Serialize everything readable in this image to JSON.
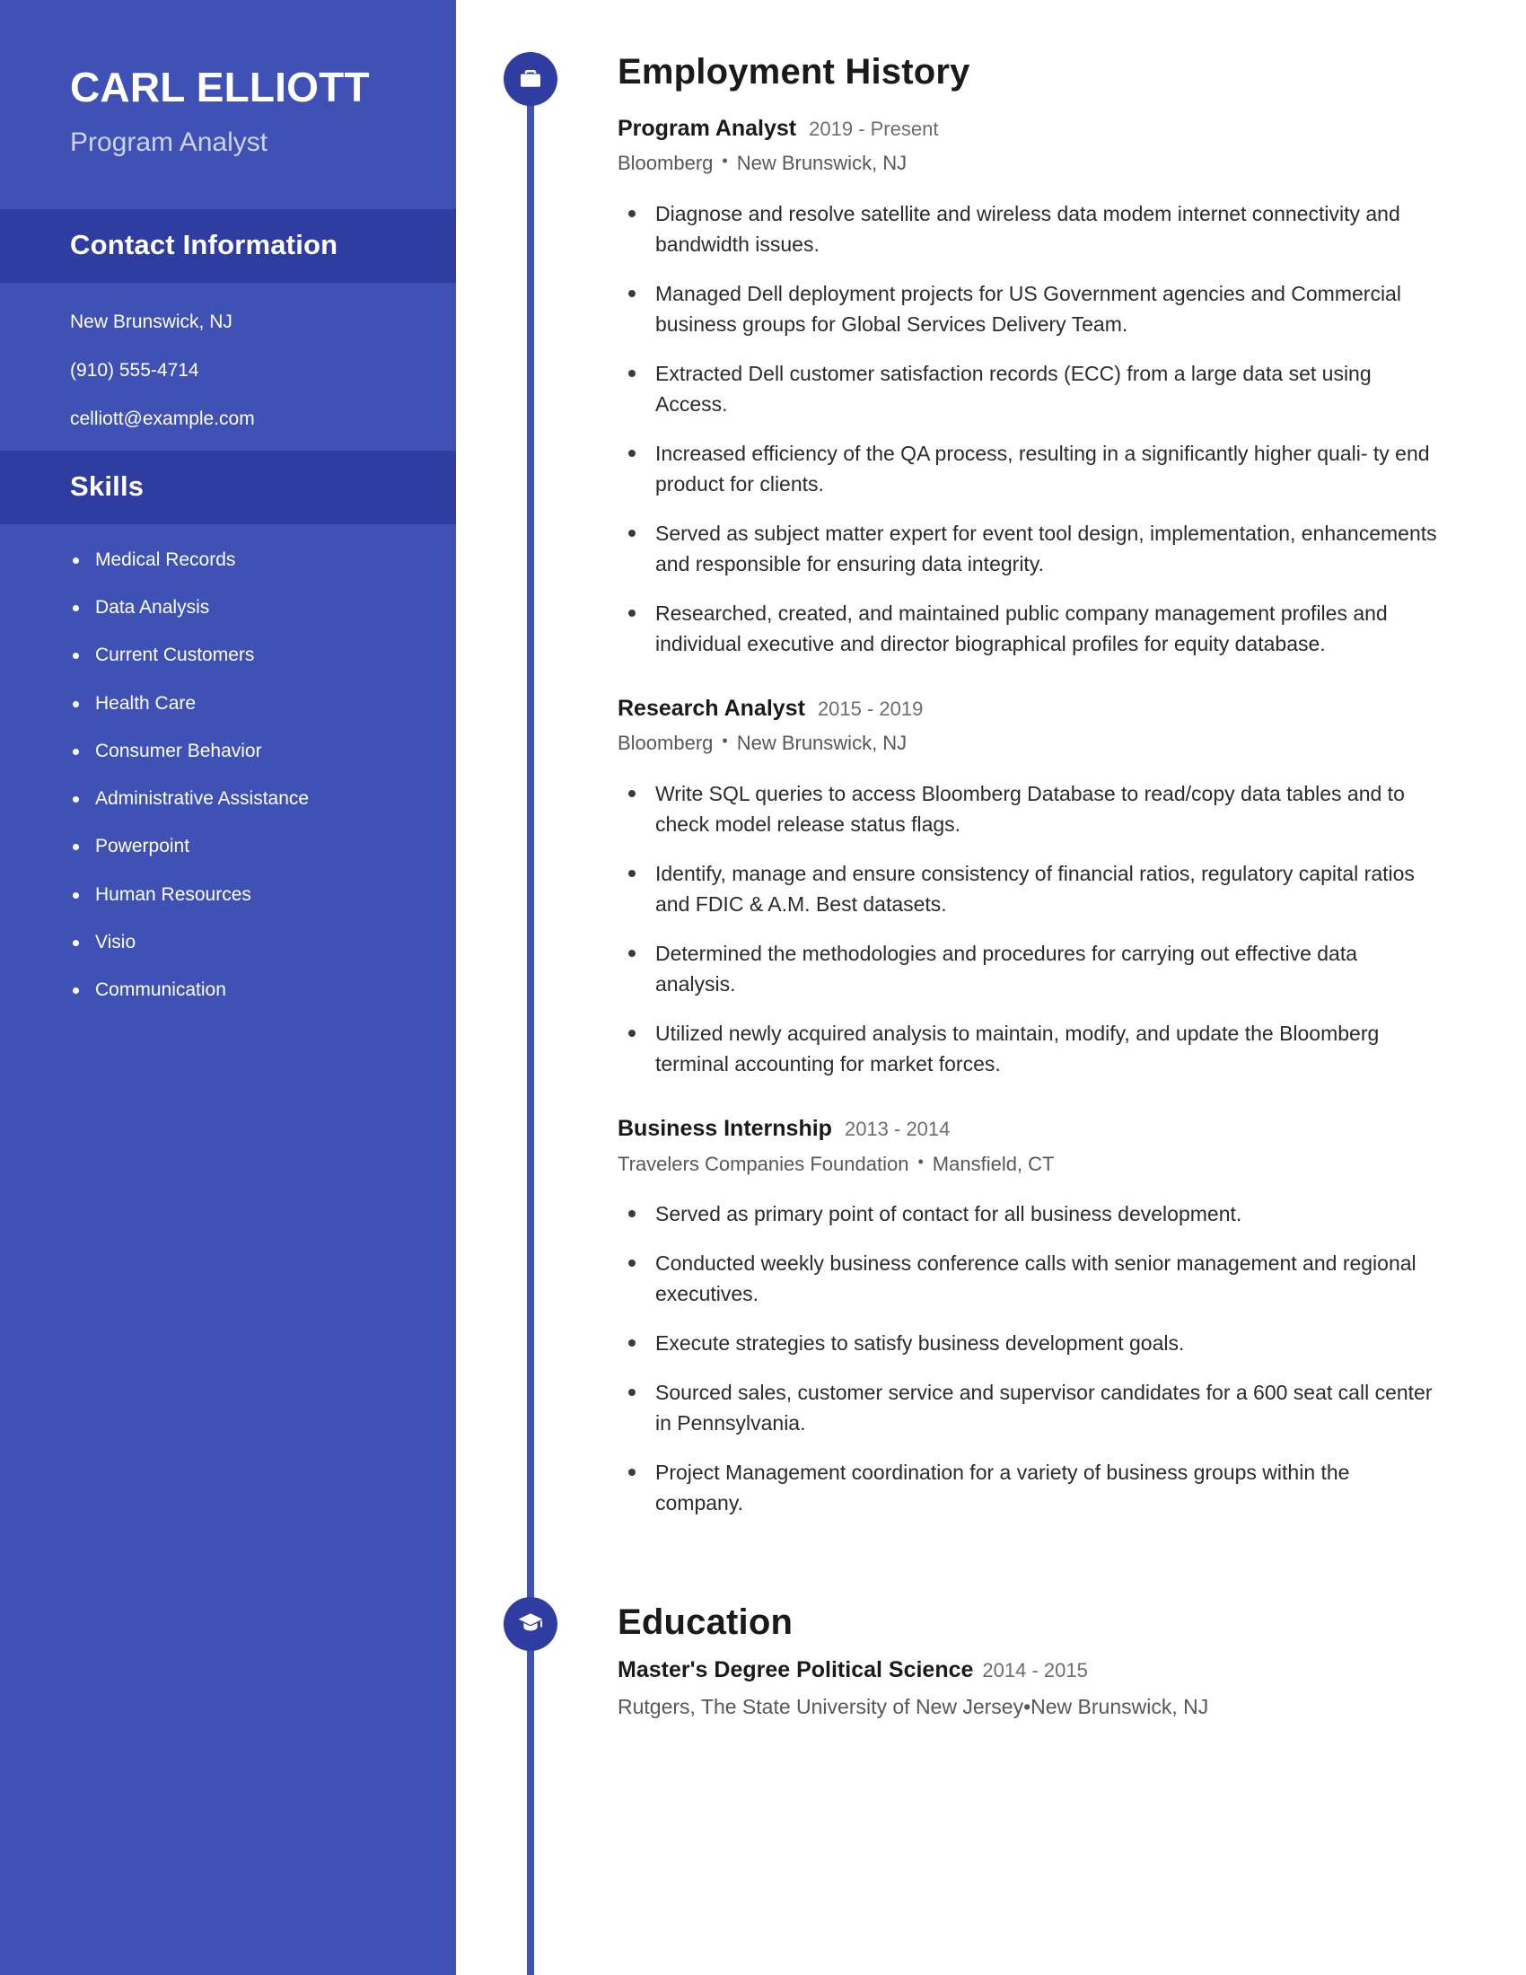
{
  "theme": {
    "sidebar_bg": "#3f51b5",
    "sidebar_band_bg": "#2f3da0",
    "accent": "#3f51b5",
    "icon_bg": "#2f3da0",
    "text_dark": "#1a1a1a",
    "text_muted": "#6d6d6d"
  },
  "sidebar": {
    "name": "CARL ELLIOTT",
    "title": "Program Analyst",
    "contact_heading": "Contact Information",
    "contact": [
      "New Brunswick, NJ",
      "(910) 555-4714",
      "celliott@example.com"
    ],
    "skills_heading": "Skills",
    "skills": [
      "Medical Records",
      "Data Analysis",
      "Current Customers",
      "Health Care",
      "Consumer Behavior",
      "Administrative Assistance",
      "Powerpoint",
      "Human Resources",
      "Visio",
      "Communication"
    ]
  },
  "employment": {
    "heading": "Employment History",
    "icon": "briefcase-icon",
    "entries": [
      {
        "role": "Program Analyst",
        "dates": "2019 - Present",
        "company": "Bloomberg",
        "location": "New Brunswick, NJ",
        "bullets": [
          "Diagnose and resolve satellite and wireless data modem internet connectivity and bandwidth issues.",
          "Managed Dell deployment projects for US Government agencies and Commercial business groups for Global Services Delivery Team.",
          "Extracted Dell customer satisfaction records (ECC) from a large data set using Access.",
          "Increased efficiency of the QA process, resulting in a significantly higher quali- ty end product for clients.",
          "Served as subject matter expert for event tool design, implementation, enhancements and responsible for ensuring data integrity.",
          "Researched, created, and maintained public company management profiles and individual executive and director biographical profiles for equity database."
        ]
      },
      {
        "role": "Research Analyst",
        "dates": "2015 - 2019",
        "company": "Bloomberg",
        "location": "New Brunswick, NJ",
        "bullets": [
          "Write SQL queries to access Bloomberg Database to read/copy data tables and to check model release status flags.",
          "Identify, manage and ensure consistency of financial ratios, regulatory capital ratios and FDIC & A.M. Best datasets.",
          "Determined the methodologies and procedures for carrying out effective data analysis.",
          "Utilized newly acquired analysis to maintain, modify, and update the Bloomberg terminal accounting for market forces."
        ]
      },
      {
        "role": "Business Internship",
        "dates": "2013 - 2014",
        "company": "Travelers Companies Foundation",
        "location": "Mansfield, CT",
        "bullets": [
          "Served as primary point of contact for all business development.",
          "Conducted weekly business conference calls with senior management and regional executives.",
          "Execute strategies to satisfy business development goals.",
          "Sourced sales, customer service and supervisor candidates for a 600 seat call center in Pennsylvania.",
          "Project Management coordination for a variety of business groups within the company."
        ]
      }
    ]
  },
  "education": {
    "heading": "Education",
    "icon": "graduation-cap-icon",
    "entries": [
      {
        "degree": "Master's Degree Political Science",
        "dates": "2014 - 2015",
        "school": "Rutgers, The State University of New Jersey",
        "location": "New Brunswick, NJ"
      }
    ]
  },
  "separator": "•"
}
